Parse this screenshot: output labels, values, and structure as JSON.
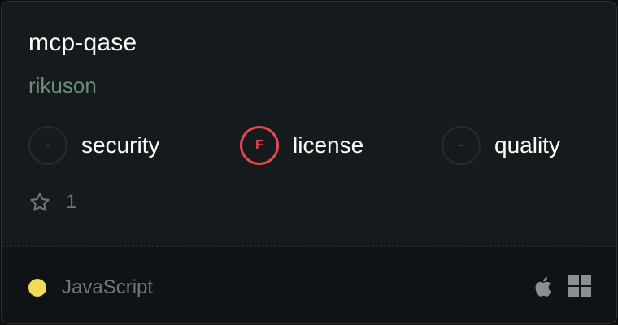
{
  "repo": {
    "name": "mcp-qase",
    "author": "rikuson"
  },
  "scores": [
    {
      "grade": "-",
      "label": "security",
      "status": "none"
    },
    {
      "grade": "F",
      "label": "license",
      "status": "fail"
    },
    {
      "grade": "-",
      "label": "quality",
      "status": "none"
    }
  ],
  "stars": {
    "icon": "star-icon",
    "count": "1"
  },
  "language": {
    "name": "JavaScript",
    "color": "#f0dc5a"
  },
  "platforms": [
    "apple-icon",
    "windows-icon"
  ]
}
